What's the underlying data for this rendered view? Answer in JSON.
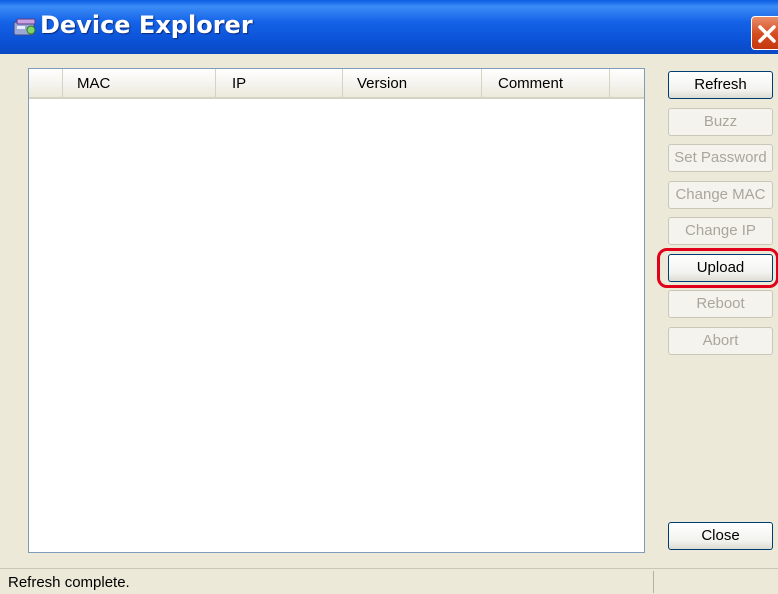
{
  "window": {
    "title": "Device Explorer",
    "title_icon": "device-explorer-icon",
    "close_icon": "close-icon"
  },
  "device_list": {
    "columns": [
      "MAC",
      "IP",
      "Version",
      "Comment"
    ],
    "rows": []
  },
  "buttons": {
    "refresh": "Refresh",
    "buzz": "Buzz",
    "set_password": "Set Password",
    "change_mac": "Change MAC",
    "change_ip": "Change IP",
    "upload": "Upload",
    "reboot": "Reboot",
    "abort": "Abort",
    "close": "Close"
  },
  "status": {
    "text": "Refresh complete."
  },
  "colors": {
    "titlebar": "#0b52d6",
    "highlight": "#e0001a"
  }
}
